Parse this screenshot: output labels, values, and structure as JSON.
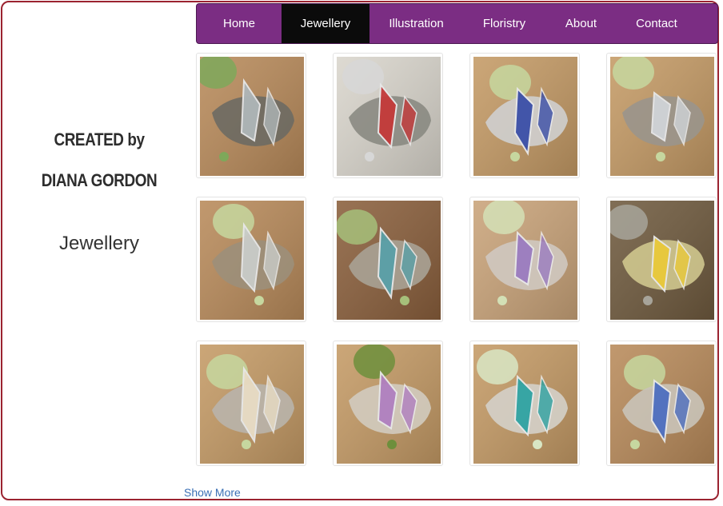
{
  "sidebar": {
    "line1": "CREATED by",
    "line2": "DIANA GORDON",
    "section": "Jewellery"
  },
  "nav": {
    "items": [
      "Home",
      "Jewellery",
      "Illustration",
      "Floristry",
      "About",
      "Contact"
    ],
    "active": "Jewellery",
    "bg_color": "#7b2d83",
    "active_color": "#0b0b0b"
  },
  "gallery": {
    "photos": [
      {
        "subject": "silver earrings on rock",
        "palette": [
          "#b88a5a",
          "#6d6a63",
          "#aeb6b8",
          "#7ea85a"
        ]
      },
      {
        "subject": "red and silver pendant",
        "palette": [
          "#d9d5cc",
          "#8a8a82",
          "#c43a3a",
          "#d7d7d7"
        ]
      },
      {
        "subject": "blue flower pendant",
        "palette": [
          "#c49a65",
          "#cfcfcf",
          "#3b4fa8",
          "#c6d79f"
        ]
      },
      {
        "subject": "silver flower pendant",
        "palette": [
          "#c49a65",
          "#9a958c",
          "#d0d4d8",
          "#c6d79f"
        ]
      },
      {
        "subject": "silver cuff pendant",
        "palette": [
          "#b88a5a",
          "#9c8f7a",
          "#c9ccc9",
          "#c6d79f"
        ]
      },
      {
        "subject": "feather earrings",
        "palette": [
          "#8a5f3c",
          "#a8a295",
          "#5aa0a8",
          "#a6c07a"
        ]
      },
      {
        "subject": "silver hoop earrings",
        "palette": [
          "#c9a379",
          "#cfc8c0",
          "#9b7cc0",
          "#d3e0b6"
        ]
      },
      {
        "subject": "citrine earrings with lily",
        "palette": [
          "#6f5a3e",
          "#cfc78e",
          "#e9c93b",
          "#a7a49a"
        ]
      },
      {
        "subject": "shell earrings",
        "palette": [
          "#c49a65",
          "#b9b4ab",
          "#e8dcc4",
          "#c6d79f"
        ]
      },
      {
        "subject": "feather pendant with flowers",
        "palette": [
          "#c49a65",
          "#d2cbbf",
          "#b080c0",
          "#6d8f3c"
        ]
      },
      {
        "subject": "swan brooch",
        "palette": [
          "#c49a65",
          "#d4d0c9",
          "#2fa3a3",
          "#d8e6c4"
        ]
      },
      {
        "subject": "opal pendant",
        "palette": [
          "#b88a5a",
          "#c9c3b8",
          "#4d6fc0",
          "#c6d79f"
        ]
      }
    ]
  },
  "show_more": "Show More"
}
